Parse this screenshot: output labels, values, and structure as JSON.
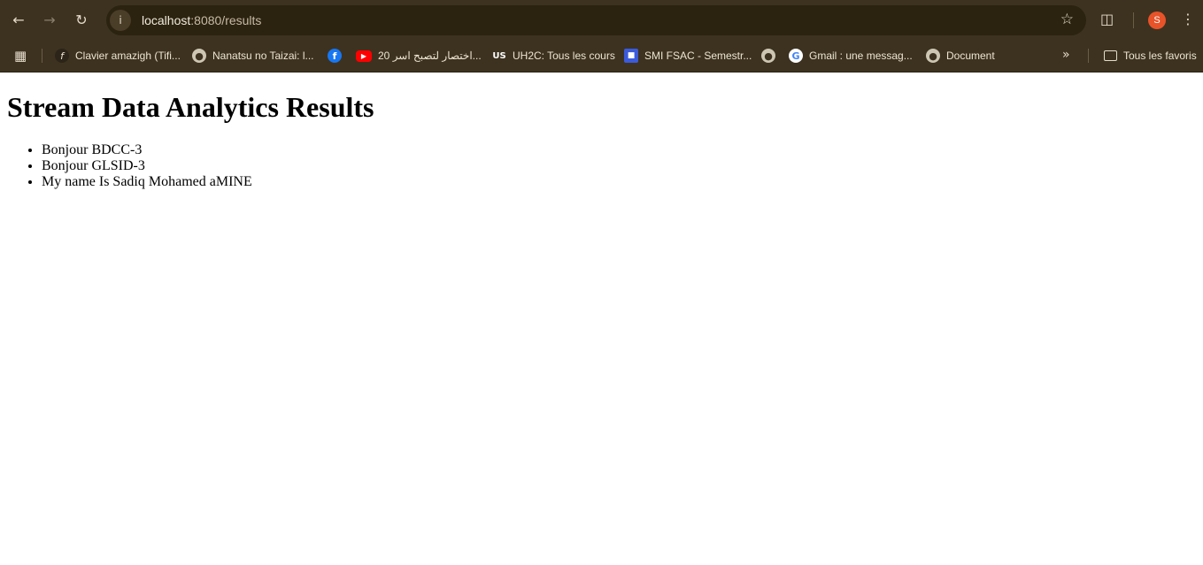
{
  "browser": {
    "url_host": "localhost",
    "url_rest": ":8080/results",
    "avatar_letter": "S",
    "bookmarks": [
      {
        "label": "Clavier amazigh (Tifi...",
        "icon": "tifinagh-icon"
      },
      {
        "label": "Nanatsu no Taizai: l...",
        "icon": "globe-icon"
      },
      {
        "label": "",
        "icon": "facebook-icon"
      },
      {
        "label": "20 اختصار لتصبح اسر...",
        "icon": "youtube-icon"
      },
      {
        "label": "UH2C: Tous les cours",
        "icon": "uh2c-icon"
      },
      {
        "label": "SMI FSAC - Semestr...",
        "icon": "smi-icon"
      },
      {
        "label": "",
        "icon": "globe-icon"
      },
      {
        "label": "Gmail : une messag...",
        "icon": "google-icon"
      },
      {
        "label": "Document",
        "icon": "globe-icon"
      }
    ],
    "all_bookmarks_label": "Tous les favoris"
  },
  "page": {
    "title": "Stream Data Analytics Results",
    "items": [
      "Bonjour BDCC-3",
      "Bonjour GLSID-3",
      "My name Is Sadiq Mohamed aMINE"
    ]
  }
}
